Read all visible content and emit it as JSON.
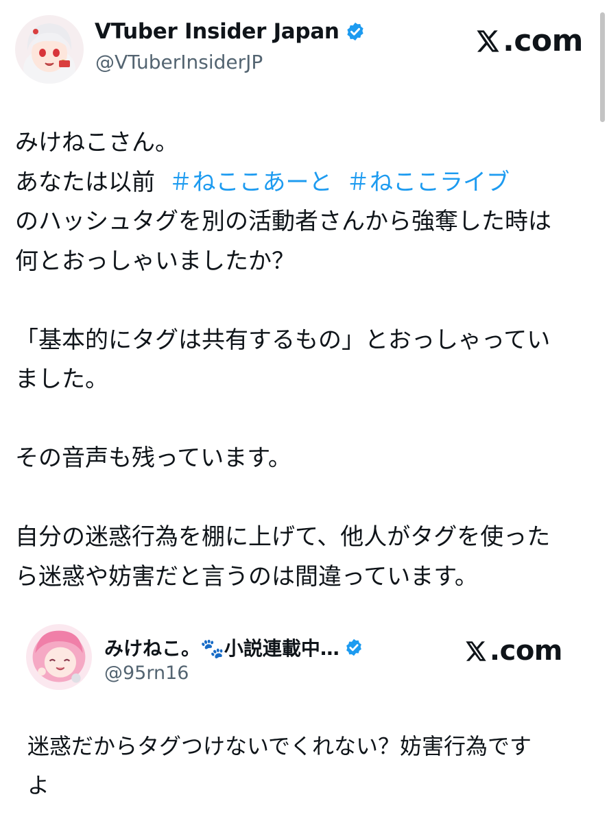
{
  "post": {
    "author": {
      "display_name": "VTuber Insider Japan",
      "handle": "@VTuberInsiderJP",
      "verified": true
    },
    "brand": "X.com",
    "body": {
      "line1": "みけねこさん。",
      "line2_prefix": "あなたは以前 ",
      "hashtag1": "＃ねここあーと",
      "hashtag2": "＃ねここライブ",
      "line3": "のハッシュタグを別の活動者さんから強奪した時は\n何とおっしゃいましたか？\n\n「基本的にタグは共有するもの」とおっしゃってい\nました。\n\nその音声も残っています。\n\n自分の迷惑行為を棚に上げて、他人がタグを使った\nら迷惑や妨害だと言うのは間違っています。"
    }
  },
  "quoted_post": {
    "author": {
      "display_name": "みけねこ。🐾小説連載中…",
      "handle": "@95rn16",
      "verified": true
    },
    "brand": "X.com",
    "body": "迷惑だからタグつけないでくれない？妨害行為です\nよ"
  },
  "colors": {
    "text": "#0f1419",
    "secondary": "#536471",
    "link": "#1d9bf0",
    "verified_badge": "#1d9bf0"
  },
  "icons": [
    "verified-badge-icon",
    "x-logo-icon",
    "paw-emoji"
  ]
}
